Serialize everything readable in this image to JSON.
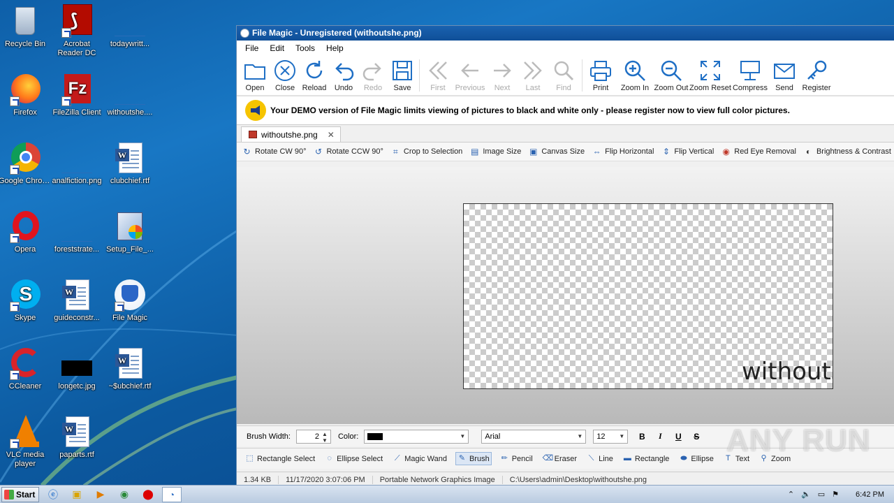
{
  "desktop": {
    "icons": [
      {
        "label": "Recycle Bin",
        "icon": "recycle-bin-icon"
      },
      {
        "label": "Acrobat Reader DC",
        "icon": "acrobat-icon"
      },
      {
        "label": "todaywritt...",
        "icon": "blank-file-icon"
      },
      {
        "label": "Firefox",
        "icon": "firefox-icon"
      },
      {
        "label": "FileZilla Client",
        "icon": "filezilla-icon"
      },
      {
        "label": "withoutshe....",
        "icon": "blank-file-icon"
      },
      {
        "label": "Google Chrome",
        "icon": "chrome-icon"
      },
      {
        "label": "analfiction.png",
        "icon": "blank-file-icon"
      },
      {
        "label": "clubchief.rtf",
        "icon": "word-doc-icon"
      },
      {
        "label": "Opera",
        "icon": "opera-icon"
      },
      {
        "label": "foreststrate...",
        "icon": "blank-file-icon"
      },
      {
        "label": "Setup_File_...",
        "icon": "setup-icon"
      },
      {
        "label": "Skype",
        "icon": "skype-icon"
      },
      {
        "label": "guideconstr...",
        "icon": "word-doc-icon"
      },
      {
        "label": "File Magic",
        "icon": "file-magic-icon"
      },
      {
        "label": "CCleaner",
        "icon": "ccleaner-icon"
      },
      {
        "label": "longetc.jpg",
        "icon": "black-image-icon"
      },
      {
        "label": "~$ubchief.rtf",
        "icon": "word-doc-icon"
      },
      {
        "label": "VLC media player",
        "icon": "vlc-icon"
      },
      {
        "label": "paparts.rtf",
        "icon": "word-doc-icon"
      }
    ]
  },
  "window": {
    "title": "File Magic - Unregistered (withoutshe.png)",
    "menu": [
      "File",
      "Edit",
      "Tools",
      "Help"
    ],
    "toolbar": [
      {
        "label": "Open",
        "icon": "folder-icon",
        "enabled": true
      },
      {
        "label": "Close",
        "icon": "close-circle-icon",
        "enabled": true
      },
      {
        "label": "Reload",
        "icon": "reload-icon",
        "enabled": true
      },
      {
        "label": "Undo",
        "icon": "undo-icon",
        "enabled": true
      },
      {
        "label": "Redo",
        "icon": "redo-icon",
        "enabled": false
      },
      {
        "label": "Save",
        "icon": "save-icon",
        "enabled": true
      },
      {
        "label": "First",
        "icon": "first-icon",
        "enabled": false
      },
      {
        "label": "Previous",
        "icon": "previous-icon",
        "enabled": false
      },
      {
        "label": "Next",
        "icon": "next-icon",
        "enabled": false
      },
      {
        "label": "Last",
        "icon": "last-icon",
        "enabled": false
      },
      {
        "label": "Find",
        "icon": "find-icon",
        "enabled": false
      },
      {
        "label": "Print",
        "icon": "print-icon",
        "enabled": true
      },
      {
        "label": "Zoom In",
        "icon": "zoom-in-icon",
        "enabled": true
      },
      {
        "label": "Zoom Out",
        "icon": "zoom-out-icon",
        "enabled": true
      },
      {
        "label": "Zoom Reset",
        "icon": "zoom-reset-icon",
        "enabled": true
      },
      {
        "label": "Compress",
        "icon": "compress-icon",
        "enabled": true
      },
      {
        "label": "Send",
        "icon": "send-mail-icon",
        "enabled": true
      },
      {
        "label": "Register",
        "icon": "register-key-icon",
        "enabled": true
      }
    ],
    "demo_message": "Your DEMO version of File Magic limits viewing of pictures to black and white only - please register now to view full color pictures.",
    "tab_label": "withoutshe.png",
    "image_tools": [
      {
        "label": "Rotate CW 90°",
        "icon": "rotate-cw-icon"
      },
      {
        "label": "Rotate CCW 90°",
        "icon": "rotate-ccw-icon"
      },
      {
        "label": "Crop to Selection",
        "icon": "crop-icon"
      },
      {
        "label": "Image Size",
        "icon": "image-size-icon"
      },
      {
        "label": "Canvas Size",
        "icon": "canvas-size-icon"
      },
      {
        "label": "Flip Horizontal",
        "icon": "flip-horizontal-icon"
      },
      {
        "label": "Flip Vertical",
        "icon": "flip-vertical-icon"
      },
      {
        "label": "Red Eye Removal",
        "icon": "red-eye-icon"
      },
      {
        "label": "Brightness & Contrast",
        "icon": "brightness-icon"
      }
    ],
    "image_text": "withouts",
    "brush": {
      "width_label": "Brush Width:",
      "width_value": "2",
      "color_label": "Color:",
      "color_value": "#000000",
      "font": "Arial",
      "font_size": "12",
      "format_buttons": [
        "B",
        "I",
        "U",
        "S"
      ]
    },
    "draw_tools": [
      {
        "label": "Rectangle Select",
        "icon": "rect-select-icon",
        "selected": false
      },
      {
        "label": "Ellipse Select",
        "icon": "ellipse-select-icon",
        "selected": false
      },
      {
        "label": "Magic Wand",
        "icon": "magic-wand-icon",
        "selected": false
      },
      {
        "label": "Brush",
        "icon": "brush-icon",
        "selected": true
      },
      {
        "label": "Pencil",
        "icon": "pencil-icon",
        "selected": false
      },
      {
        "label": "Eraser",
        "icon": "eraser-icon",
        "selected": false
      },
      {
        "label": "Line",
        "icon": "line-icon",
        "selected": false
      },
      {
        "label": "Rectangle",
        "icon": "rectangle-icon",
        "selected": false
      },
      {
        "label": "Ellipse",
        "icon": "ellipse-icon",
        "selected": false
      },
      {
        "label": "Text",
        "icon": "text-icon",
        "selected": false
      },
      {
        "label": "Zoom",
        "icon": "zoom-icon",
        "selected": false
      }
    ],
    "status": {
      "size": "1.34 KB",
      "date": "11/17/2020 3:07:06 PM",
      "type": "Portable Network Graphics Image",
      "path": "C:\\Users\\admin\\Desktop\\withoutshe.png"
    }
  },
  "watermark": "ANY RUN",
  "taskbar": {
    "start_label": "Start",
    "clock": "6:42 PM"
  }
}
